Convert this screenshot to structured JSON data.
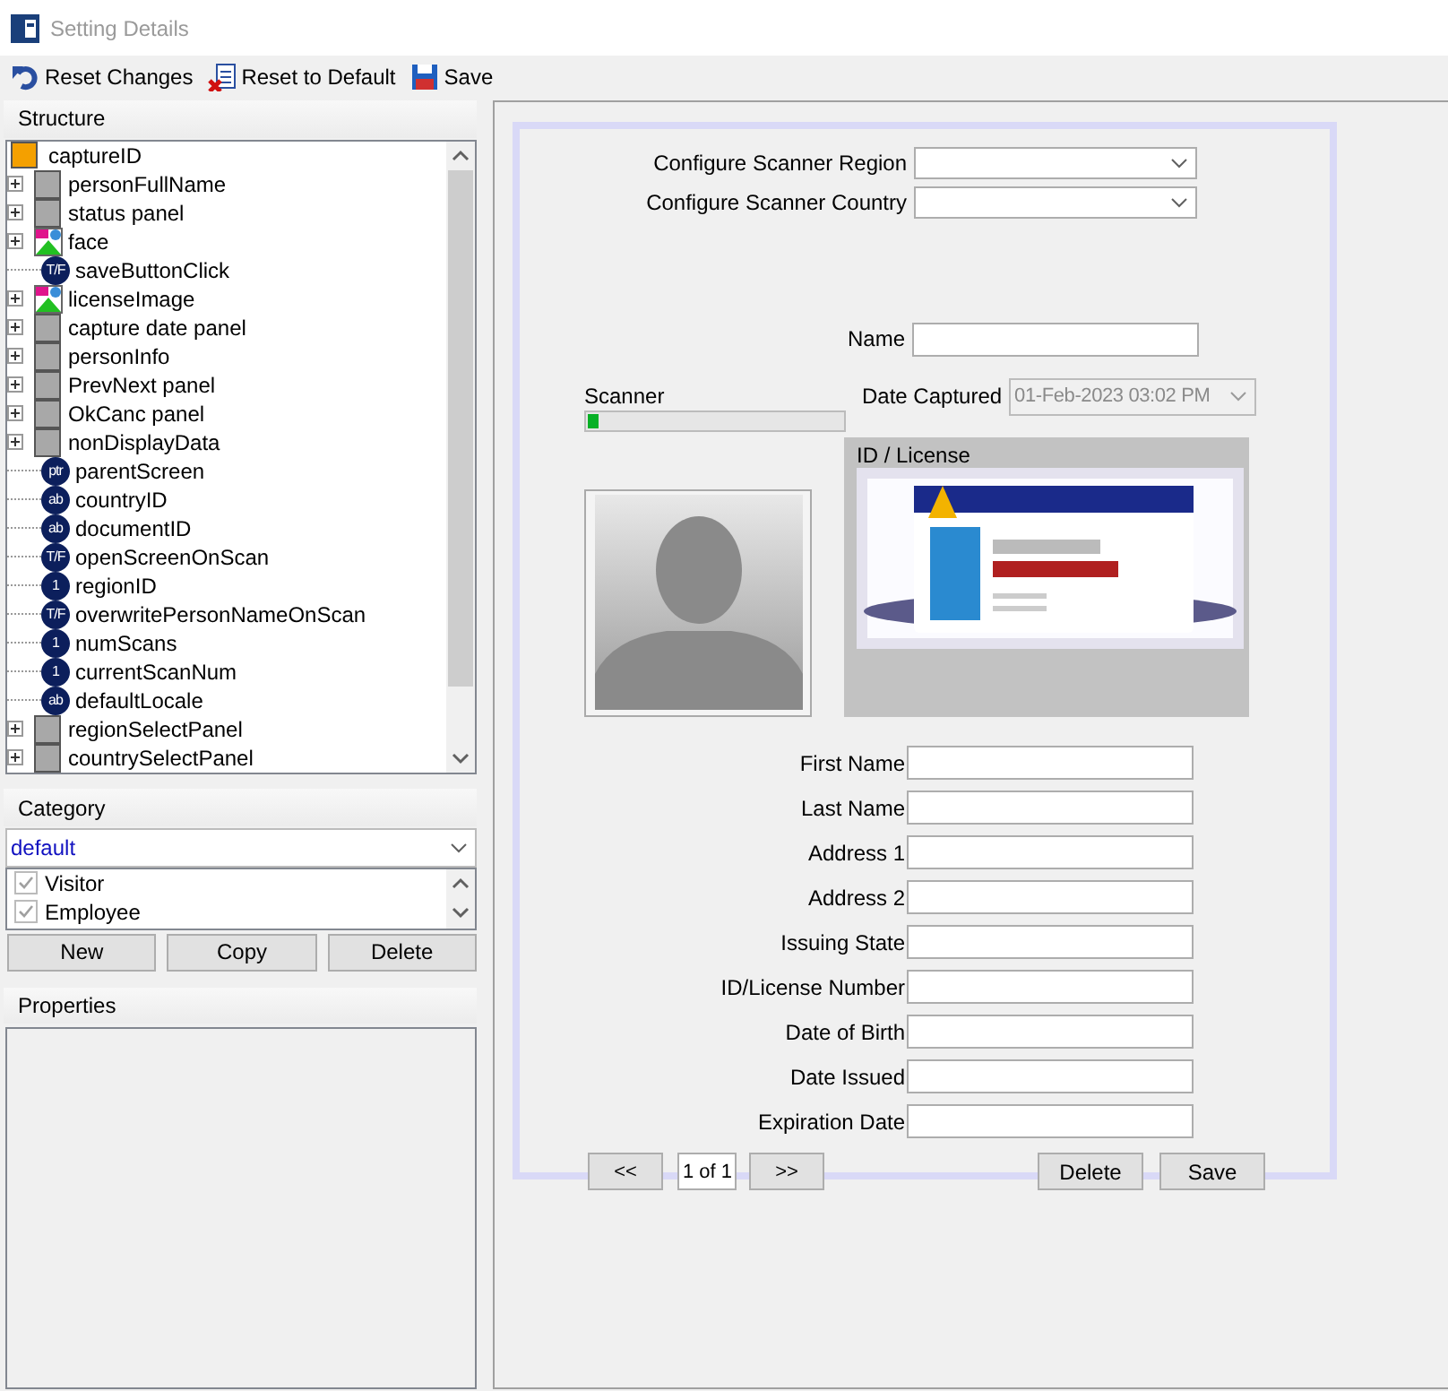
{
  "window": {
    "title": "Setting Details"
  },
  "toolbar": [
    {
      "label": "Reset Changes"
    },
    {
      "label": "Reset to Default"
    },
    {
      "label": "Save"
    }
  ],
  "structure": {
    "title": "Structure",
    "tree": {
      "label": "captureID",
      "kind": "root",
      "children": [
        {
          "label": "personFullName",
          "kind": "panel",
          "expanded": false
        },
        {
          "label": "status panel",
          "kind": "panel",
          "expanded": false
        },
        {
          "label": "face",
          "kind": "image",
          "expanded": false
        },
        {
          "label": "saveButtonClick",
          "kind": "value",
          "badge": "T/F"
        },
        {
          "label": "licenseImage",
          "kind": "image",
          "expanded": false
        },
        {
          "label": "capture date panel",
          "kind": "panel",
          "expanded": false
        },
        {
          "label": "personInfo",
          "kind": "panel",
          "expanded": false
        },
        {
          "label": "PrevNext panel",
          "kind": "panel",
          "expanded": false
        },
        {
          "label": "OkCanc panel",
          "kind": "panel",
          "expanded": false
        },
        {
          "label": "nonDisplayData",
          "kind": "panel",
          "expanded": false
        },
        {
          "label": "parentScreen",
          "kind": "value",
          "badge": "ptr"
        },
        {
          "label": "countryID",
          "kind": "value",
          "badge": "ab"
        },
        {
          "label": "documentID",
          "kind": "value",
          "badge": "ab"
        },
        {
          "label": "openScreenOnScan",
          "kind": "value",
          "badge": "T/F"
        },
        {
          "label": "regionID",
          "kind": "value",
          "badge": "1"
        },
        {
          "label": "overwritePersonNameOnScan",
          "kind": "value",
          "badge": "T/F"
        },
        {
          "label": "numScans",
          "kind": "value",
          "badge": "1"
        },
        {
          "label": "currentScanNum",
          "kind": "value",
          "badge": "1"
        },
        {
          "label": "defaultLocale",
          "kind": "value",
          "badge": "ab"
        },
        {
          "label": "regionSelectPanel",
          "kind": "panel",
          "expanded": false
        },
        {
          "label": "countrySelectPanel",
          "kind": "panel",
          "expanded": false
        }
      ]
    }
  },
  "category": {
    "title": "Category",
    "value": "default",
    "items": [
      {
        "label": "Visitor",
        "checked": true
      },
      {
        "label": "Employee",
        "checked": true
      }
    ],
    "buttons": [
      "New",
      "Copy",
      "Delete"
    ]
  },
  "properties": {
    "title": "Properties"
  },
  "form": {
    "selects": [
      {
        "label": "Configure Scanner Region"
      },
      {
        "label": "Configure Scanner Country"
      }
    ],
    "name_label": "Name",
    "scanner": {
      "label": "Scanner",
      "level": 0.04
    },
    "date_captured": {
      "label": "Date Captured",
      "value": "01-Feb-2023 03:02 PM",
      "disabled": true
    },
    "id_panel": {
      "title": "ID / License"
    },
    "fields": [
      "First Name",
      "Last Name",
      "Address 1",
      "Address 2",
      "Issuing State",
      "ID/License Number",
      "Date of Birth",
      "Date Issued",
      "Expiration Date"
    ],
    "pager": {
      "prev": "<<",
      "page": "1 of 1",
      "next": ">>"
    },
    "actions": [
      "Delete",
      "Save"
    ]
  }
}
